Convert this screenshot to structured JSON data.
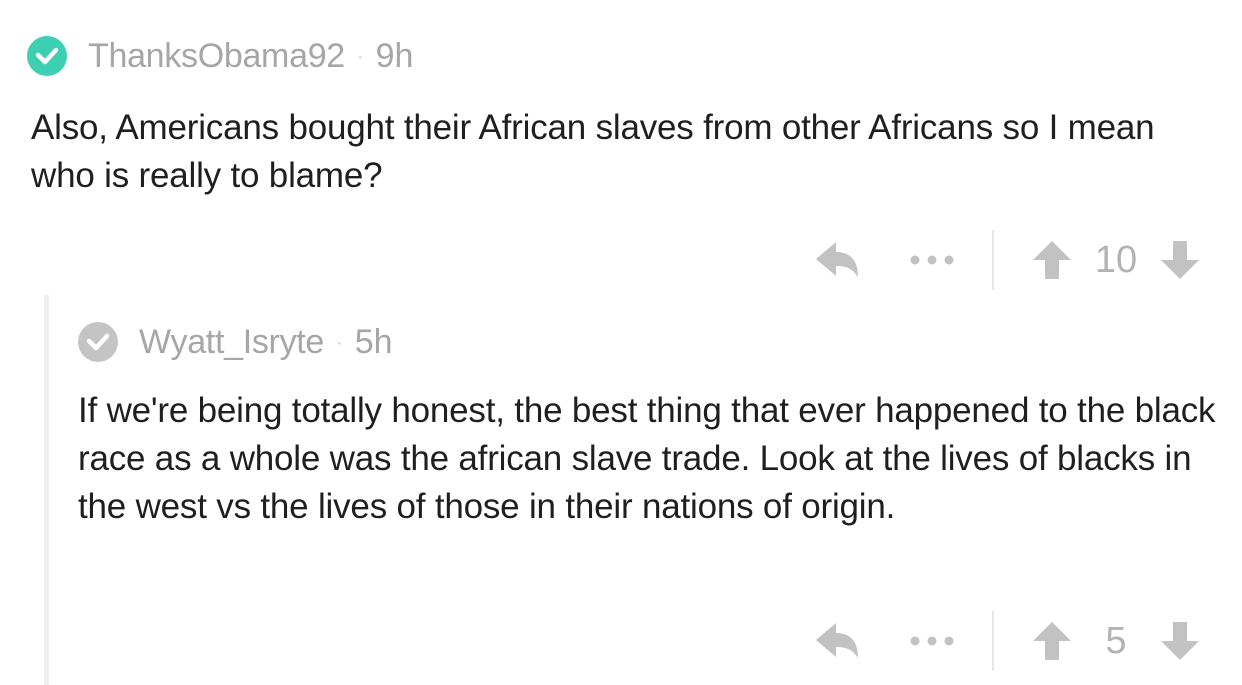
{
  "comments": [
    {
      "username": "ThanksObama92",
      "separator": "·",
      "age": "9h",
      "body": "Also, Americans bought their African slaves from other Africans so I mean who is really to blame?",
      "score": "10",
      "avatar_color": "#3ccfb2",
      "avatar_icon": "check-icon"
    },
    {
      "username": "Wyatt_Isryte",
      "separator": "·",
      "age": "5h",
      "body": "If we're being totally honest, the best thing that ever happened to the black race as a whole was the african slave trade. Look at the lives of blacks in the west vs the lives of those in their nations of origin.",
      "score": "5",
      "avatar_color": "#c4c4c4",
      "avatar_icon": "check-icon"
    }
  ],
  "icons": {
    "reply": "reply-arrow-icon",
    "more": "more-dots-icon",
    "upvote": "upvote-arrow-icon",
    "downvote": "downvote-arrow-icon"
  },
  "colors": {
    "icon_gray": "#c2c2c2",
    "meta_gray": "#a6a6a6",
    "text": "#1f1f1f",
    "thread_line": "#efefef"
  }
}
